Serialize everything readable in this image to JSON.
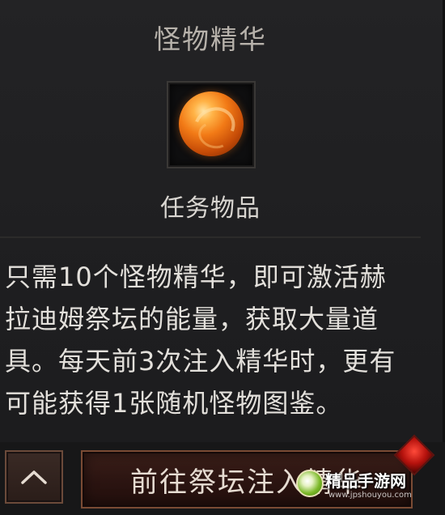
{
  "tooltip": {
    "title": "怪物精华",
    "item_icon": "orange-orb-icon",
    "item_type": "任务物品",
    "description_lines": [
      "只需10个怪物精华，即可激活赫",
      "拉迪姆祭坛的能量，获取大量道",
      "具。每天前3次注入精华时，更有",
      "可能获得1张随机怪物图鉴。"
    ]
  },
  "actions": {
    "collapse_icon": "chevron-up-icon",
    "primary_label": "前往祭坛注入精华"
  },
  "watermark": {
    "text": "精品手游网",
    "url": "www.jpshouyou.com"
  },
  "colors": {
    "background": "#1c1c1e",
    "title": "#b7b2ab",
    "body_text": "#e3e0db",
    "button_border": "#7a4b34",
    "orb": "#f27a16"
  }
}
